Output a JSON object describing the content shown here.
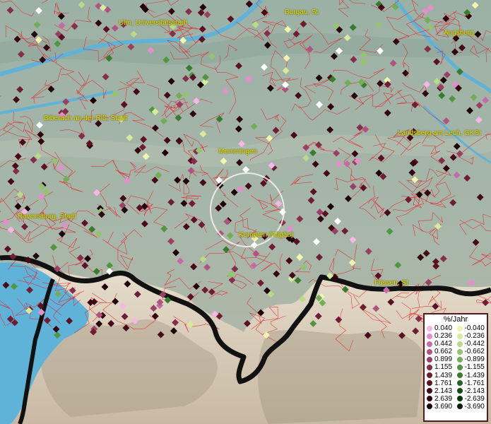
{
  "map": {
    "cities": [
      {
        "id": "ulm",
        "label": "Ulm, Universitätsstadt"
      },
      {
        "id": "burgau",
        "label": "Burgau, St"
      },
      {
        "id": "augsburg",
        "label": "Augsburg"
      },
      {
        "id": "biberach",
        "label": "Biberach an der Riß, Stadt"
      },
      {
        "id": "memmingen",
        "label": "Memmingen"
      },
      {
        "id": "landsberg",
        "label": "Landsberg am Lech, GKSt"
      },
      {
        "id": "ravensburg",
        "label": "Ravensburg, Stadt"
      },
      {
        "id": "kempten",
        "label": "Kempten (Allgäu)"
      },
      {
        "id": "fuessen",
        "label": "Füssen, St"
      }
    ],
    "colors": {
      "water": "#5fb3d9",
      "boundary": "#e8222a",
      "border": "#111111",
      "label": "#e8e000"
    }
  },
  "legend": {
    "title": "%/Jahr",
    "positive": [
      {
        "value": "0.040",
        "color": "#f7b6e6"
      },
      {
        "value": "0.236",
        "color": "#e58ecd"
      },
      {
        "value": "0.442",
        "color": "#c76aa8"
      },
      {
        "value": "0.662",
        "color": "#b0547f"
      },
      {
        "value": "0.899",
        "color": "#9c3f64"
      },
      {
        "value": "1.155",
        "color": "#862d4a"
      },
      {
        "value": "1.439",
        "color": "#701c33"
      },
      {
        "value": "1.761",
        "color": "#5c1024"
      },
      {
        "value": "2.143",
        "color": "#470818"
      },
      {
        "value": "2.639",
        "color": "#330310"
      },
      {
        "value": "3.690",
        "color": "#1f0008"
      }
    ],
    "negative": [
      {
        "value": "-0.040",
        "color": "#f0f5b0"
      },
      {
        "value": "-0.236",
        "color": "#d8ea9c"
      },
      {
        "value": "-0.442",
        "color": "#b9da88"
      },
      {
        "value": "-0.662",
        "color": "#94c46e"
      },
      {
        "value": "-0.899",
        "color": "#72ae55"
      },
      {
        "value": "-1.155",
        "color": "#519640"
      },
      {
        "value": "-1.439",
        "color": "#367d2e"
      },
      {
        "value": "-1.761",
        "color": "#226420"
      },
      {
        "value": "-2.143",
        "color": "#134c14"
      },
      {
        "value": "-2.639",
        "color": "#09350b"
      },
      {
        "value": "-3.690",
        "color": "#042004"
      }
    ]
  }
}
